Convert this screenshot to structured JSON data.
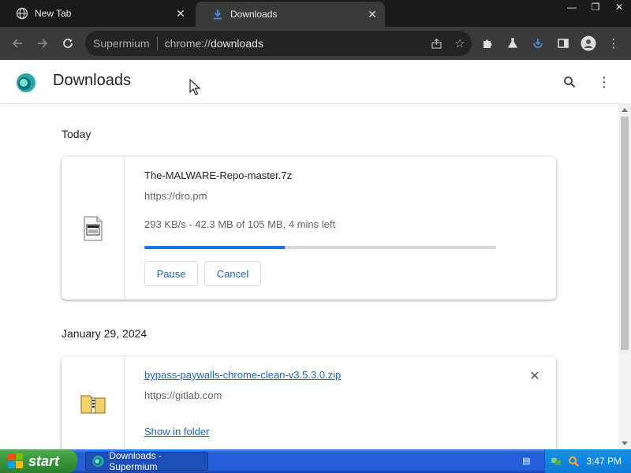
{
  "tabs": [
    {
      "title": "New Tab",
      "icon": "globe-icon",
      "active": false
    },
    {
      "title": "Downloads",
      "icon": "download-icon",
      "active": true
    }
  ],
  "window_controls": {
    "minimize": "—",
    "restore": "❐",
    "close": "✕"
  },
  "omnibox": {
    "brand": "Supermium",
    "url_prefix": "chrome://",
    "url_host": "downloads"
  },
  "page": {
    "title": "Downloads"
  },
  "groups": [
    {
      "date": "Today",
      "item": {
        "file_name": "The-MALWARE-Repo-master.7z",
        "url": "https://dro.pm",
        "status": "293 KB/s - 42.3 MB of 105 MB, 4 mins left",
        "progress": 0.4,
        "pause_label": "Pause",
        "cancel_label": "Cancel"
      }
    },
    {
      "date": "January 29, 2024",
      "item": {
        "file_name": "bypass-paywalls-chrome-clean-v3.5.3.0.zip",
        "url": "https://gitlab.com",
        "show_in_folder_label": "Show in folder"
      }
    }
  ],
  "taskbar": {
    "start_label": "start",
    "task_title": "Downloads - Supermium",
    "clock": "3:47 PM"
  },
  "colors": {
    "accent": "#1a73e8",
    "link": "#1a66c8",
    "tab_bar": "#1a1a1a",
    "toolbar": "#3a3a3a"
  }
}
